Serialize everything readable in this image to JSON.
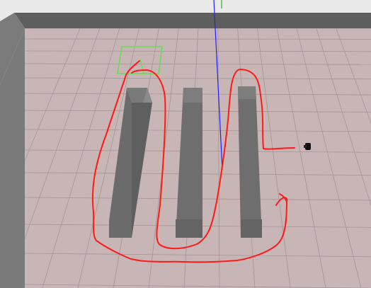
{
  "scene": {
    "colors": {
      "background": "#ffffff",
      "wall_top": "#5e5e5e",
      "wall_side": "#7b7b7b",
      "floor": "#c8b5b6",
      "grid": "#a39596",
      "shelf_front": "#6b6b6b",
      "shelf_side": "#8a8a8a",
      "shelf_top": "#7a7a7a",
      "path": "#ff1a1a",
      "goal_marker": "#66dd55",
      "z_axis": "#2020ff",
      "y_axis": "#22bb22",
      "robot": "#111111"
    },
    "objects": {
      "shelves": [
        "shelf-left",
        "shelf-middle",
        "shelf-right"
      ],
      "path": "planned-path",
      "goal": "goal-marker",
      "robot": "robot"
    }
  }
}
